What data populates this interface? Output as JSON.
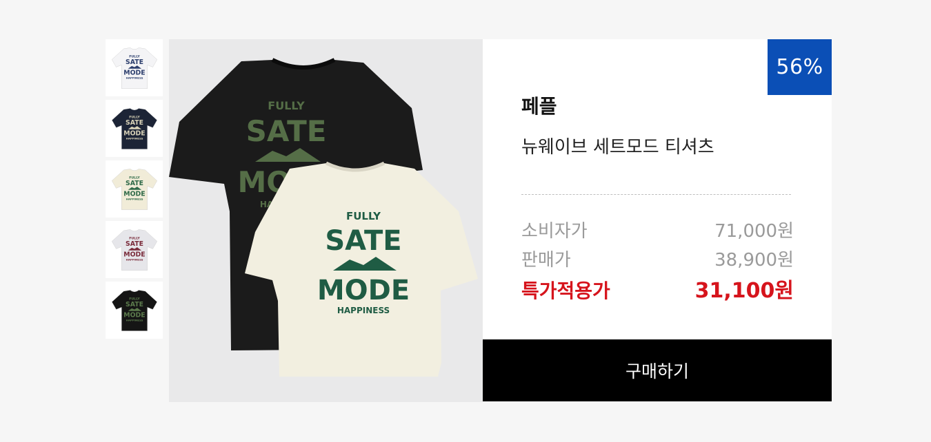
{
  "thumbnails": [
    {
      "color_name": "white",
      "shirt_color": "#f4f4f6",
      "print_color": "#2d3f6e"
    },
    {
      "color_name": "navy",
      "shirt_color": "#1c2436",
      "print_color": "#d8d2b8"
    },
    {
      "color_name": "cream",
      "shirt_color": "#f1ecd8",
      "print_color": "#2f6a48"
    },
    {
      "color_name": "light-gray",
      "shirt_color": "#e6e6ea",
      "print_color": "#7a2b3a"
    },
    {
      "color_name": "black",
      "shirt_color": "#151515",
      "print_color": "#5b7a4c"
    }
  ],
  "main_image": {
    "back_shirt_color": "#1b1b1b",
    "back_print_color": "#556e47",
    "front_shirt_color": "#f2efe0",
    "front_print_color": "#1f5c44",
    "print_lines": [
      "FULLY",
      "SATE",
      "MODE",
      "HAPPINESS"
    ]
  },
  "badge": {
    "text": "56%",
    "color": "#0b4fb6"
  },
  "product": {
    "brand": "페플",
    "name": "뉴웨이브 세트모드 티셔츠"
  },
  "prices": {
    "consumer_label": "소비자가",
    "consumer_value": "71,000원",
    "sale_label": "판매가",
    "sale_value": "38,900원",
    "special_label": "특가적용가",
    "special_value": "31,100원",
    "special_color": "#d6141c"
  },
  "buy_button": {
    "label": "구매하기"
  }
}
